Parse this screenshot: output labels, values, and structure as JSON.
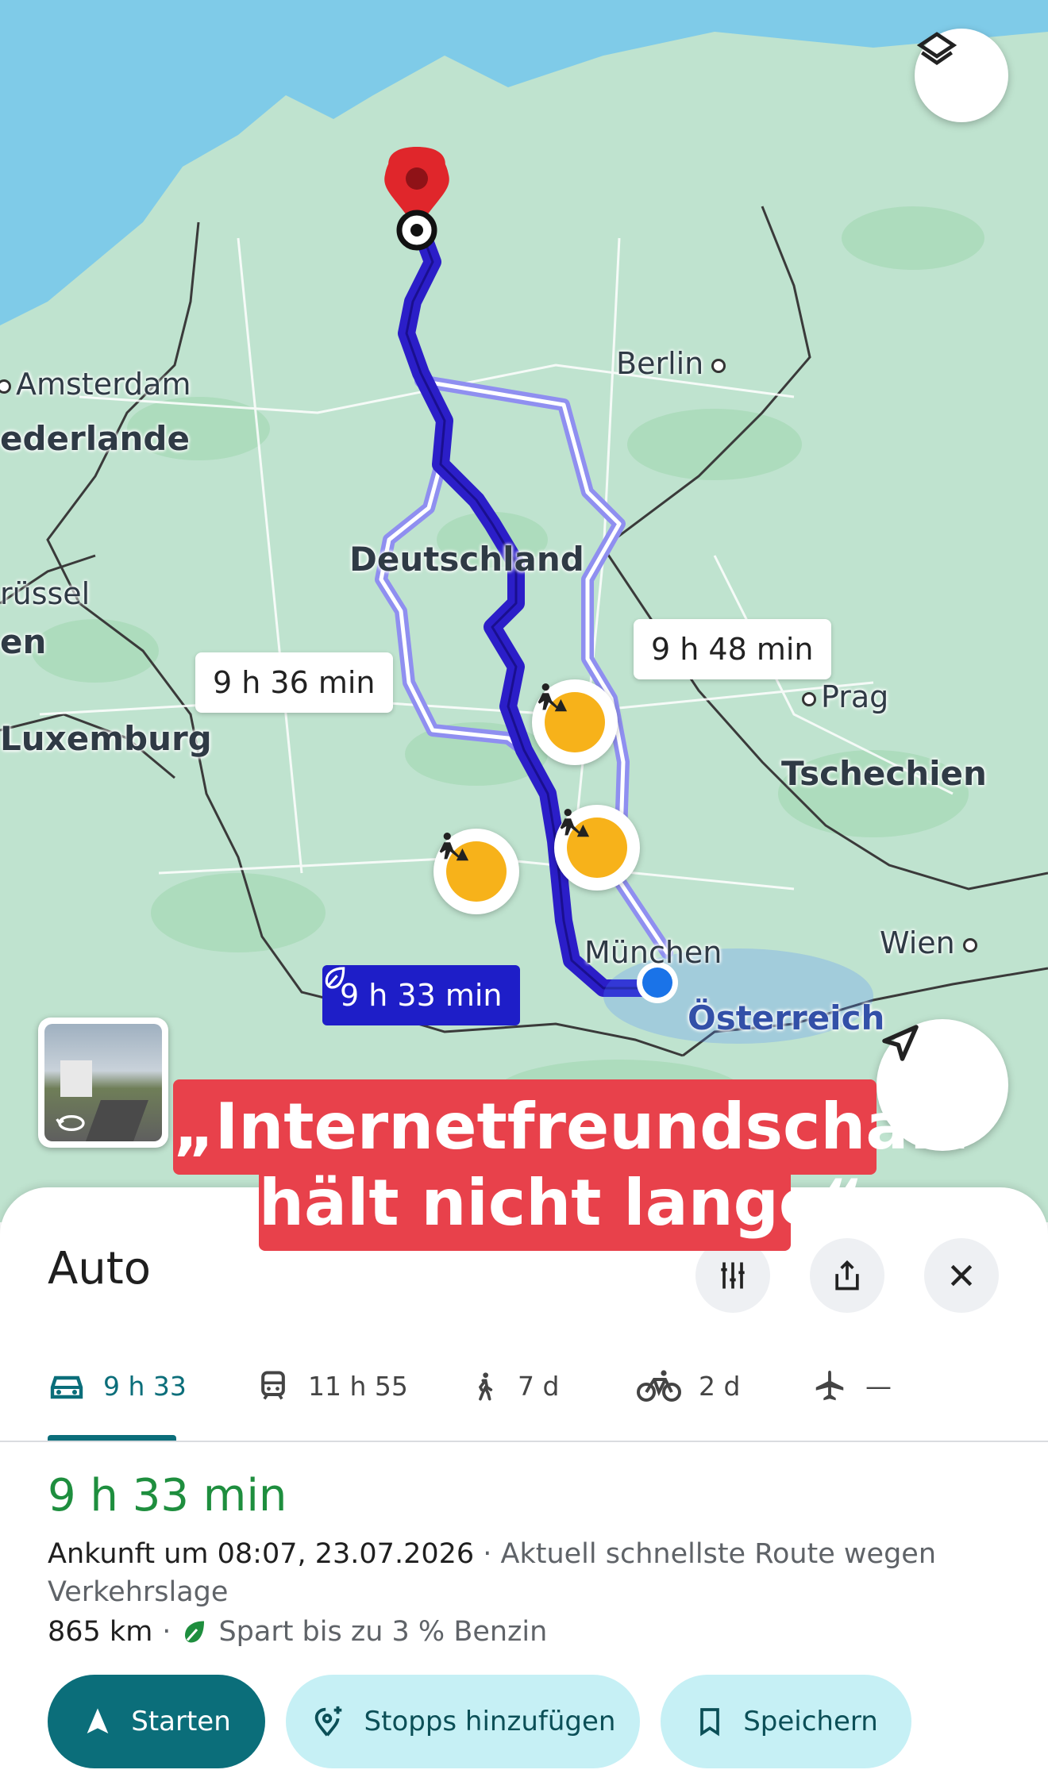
{
  "map": {
    "cities": {
      "amsterdam": "Amsterdam",
      "berlin": "Berlin",
      "brussel": "rüssel",
      "prag": "Prag",
      "muenchen": "München",
      "wien": "Wien"
    },
    "countries": {
      "niederlande": "ederlande",
      "deutschland": "Deutschland",
      "belgien": "en",
      "luxemburg": "Luxemburg",
      "tschechien": "Tschechien",
      "oesterreich": "Österreich"
    },
    "route_times": {
      "main": "9 h 33 min",
      "alt_west": "9 h 36 min",
      "alt_east": "9 h 48 min"
    }
  },
  "overlay": {
    "line1": "„Internetfreundschaft",
    "line2": "hält nicht lange“"
  },
  "sheet": {
    "title": "Auto",
    "modes": [
      {
        "icon": "car-icon",
        "label": "9 h 33",
        "active": true
      },
      {
        "icon": "train-icon",
        "label": "11 h 55"
      },
      {
        "icon": "walk-icon",
        "label": "7 d"
      },
      {
        "icon": "bike-icon",
        "label": "2 d"
      },
      {
        "icon": "plane-icon",
        "label": "—"
      }
    ],
    "duration": "9 h 33 min",
    "arrival": "Ankunft um 08:07, 23.07.2026",
    "arrival_note": " · Aktuell schnellste Route wegen Verkehrslage",
    "distance": "865 km",
    "separator": "·",
    "fuel_note": "Spart bis zu 3 % Benzin",
    "buttons": {
      "start": "Starten",
      "add_stops": "Stopps hinzufügen",
      "save": "Speichern"
    }
  },
  "colors": {
    "route_main": "#2b1ec8",
    "route_alt": "#8f8ff0",
    "accent": "#0b6e7a",
    "duration_green": "#1e8e3e",
    "overlay_red": "#e8414b",
    "location_blue": "#1a73e8",
    "pin_red": "#e0262b"
  }
}
